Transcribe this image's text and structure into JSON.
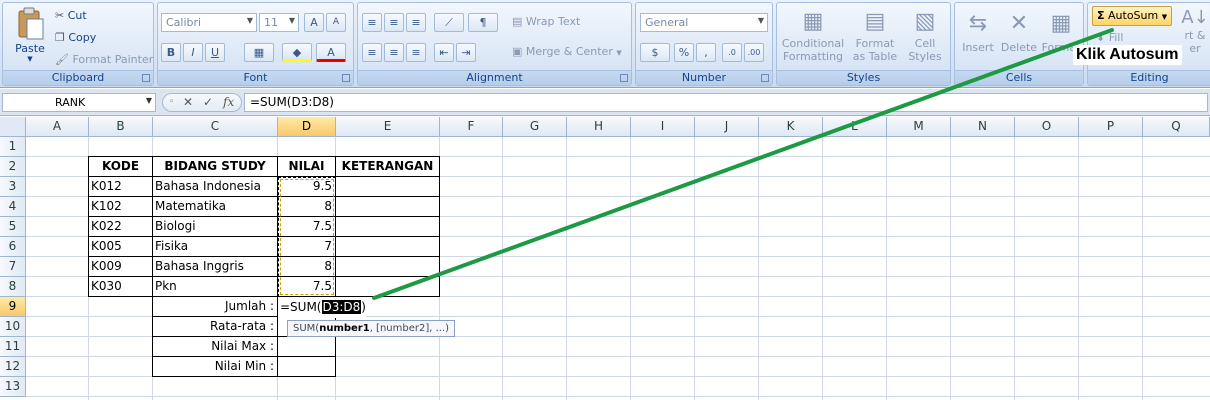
{
  "ribbon": {
    "clipboard": {
      "label": "Clipboard",
      "paste": "Paste",
      "cut": "Cut",
      "copy": "Copy",
      "format_painter": "Format Painter"
    },
    "font": {
      "label": "Font",
      "font_name": "Calibri",
      "font_size": "11"
    },
    "alignment": {
      "label": "Alignment",
      "wrap_text": "Wrap Text",
      "merge_center": "Merge & Center"
    },
    "number": {
      "label": "Number",
      "format": "General"
    },
    "styles": {
      "label": "Styles",
      "conditional": "Conditional",
      "formatting": "Formatting",
      "format": "Format",
      "as_table": "as Table",
      "cell": "Cell",
      "styles_btn": "Styles"
    },
    "cells": {
      "label": "Cells",
      "insert": "Insert",
      "delete": "Delete",
      "format": "Format"
    },
    "editing": {
      "label": "Editing",
      "autosum": "AutoSum",
      "fill": "Fill",
      "sort_fragment": "rt &",
      "filter_fragment": "er"
    }
  },
  "formula_bar": {
    "name_box": "RANK",
    "formula": "=SUM(D3:D8)"
  },
  "columns": [
    "A",
    "B",
    "C",
    "D",
    "E",
    "F",
    "G",
    "H",
    "I",
    "J",
    "K",
    "L",
    "M",
    "N",
    "O",
    "P",
    "Q"
  ],
  "rows": [
    "1",
    "2",
    "3",
    "4",
    "5",
    "6",
    "7",
    "8",
    "9",
    "10",
    "11",
    "12",
    "13"
  ],
  "sheet": {
    "headers": {
      "kode": "KODE",
      "bidang": "BIDANG STUDY",
      "nilai": "NILAI",
      "keterangan": "KETERANGAN"
    },
    "records": [
      {
        "kode": "K012",
        "bidang": "Bahasa Indonesia",
        "nilai": "9.5"
      },
      {
        "kode": "K102",
        "bidang": "Matematika",
        "nilai": "8"
      },
      {
        "kode": "K022",
        "bidang": "Biologi",
        "nilai": "7.5"
      },
      {
        "kode": "K005",
        "bidang": "Fisika",
        "nilai": "7"
      },
      {
        "kode": "K009",
        "bidang": "Bahasa Inggris",
        "nilai": "8"
      },
      {
        "kode": "K030",
        "bidang": "Pkn",
        "nilai": "7.5"
      }
    ],
    "summary_labels": [
      "Jumlah :",
      "Rata-rata :",
      "Nilai Max :",
      "Nilai Min :"
    ],
    "editing_prefix": "=SUM(",
    "editing_ref": "D3:D8",
    "editing_suffix": ")",
    "tooltip_fn": "SUM(",
    "tooltip_arg1": "number1",
    "tooltip_rest": ", [number2], ...)"
  },
  "annotation": {
    "text": "Klik Autosum",
    "arrow_color": "#1e9a45"
  }
}
